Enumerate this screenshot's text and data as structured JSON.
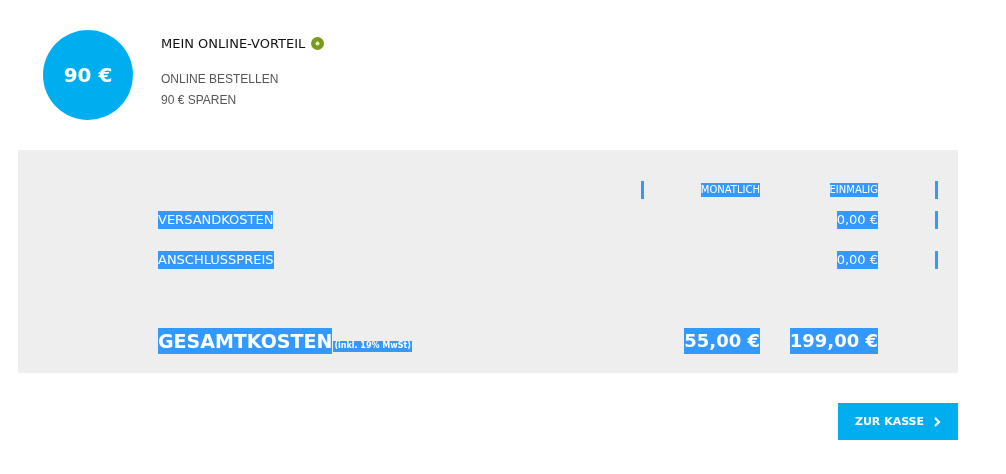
{
  "advantage": {
    "amount": "90 €",
    "title": "MEIN ONLINE-VORTEIL",
    "lines": [
      "ONLINE BESTELLEN",
      "90 € SPAREN"
    ]
  },
  "costs": {
    "text_selected": true,
    "columns": [
      "MONATLICH",
      "EINMALIG"
    ],
    "rows": [
      {
        "kind": "item",
        "label": "VERSANDKOSTEN",
        "monthly": "",
        "once": "0,00 €"
      },
      {
        "kind": "item",
        "label": "ANSCHLUSSPREIS",
        "monthly": "",
        "once": "0,00 €"
      },
      {
        "kind": "total",
        "label": "GESAMTKOSTEN",
        "note": "(inkl. 19% MwSt)",
        "monthly": "55,00 €",
        "once": "199,00 €"
      }
    ]
  },
  "checkout_button": "ZUR KASSE"
}
